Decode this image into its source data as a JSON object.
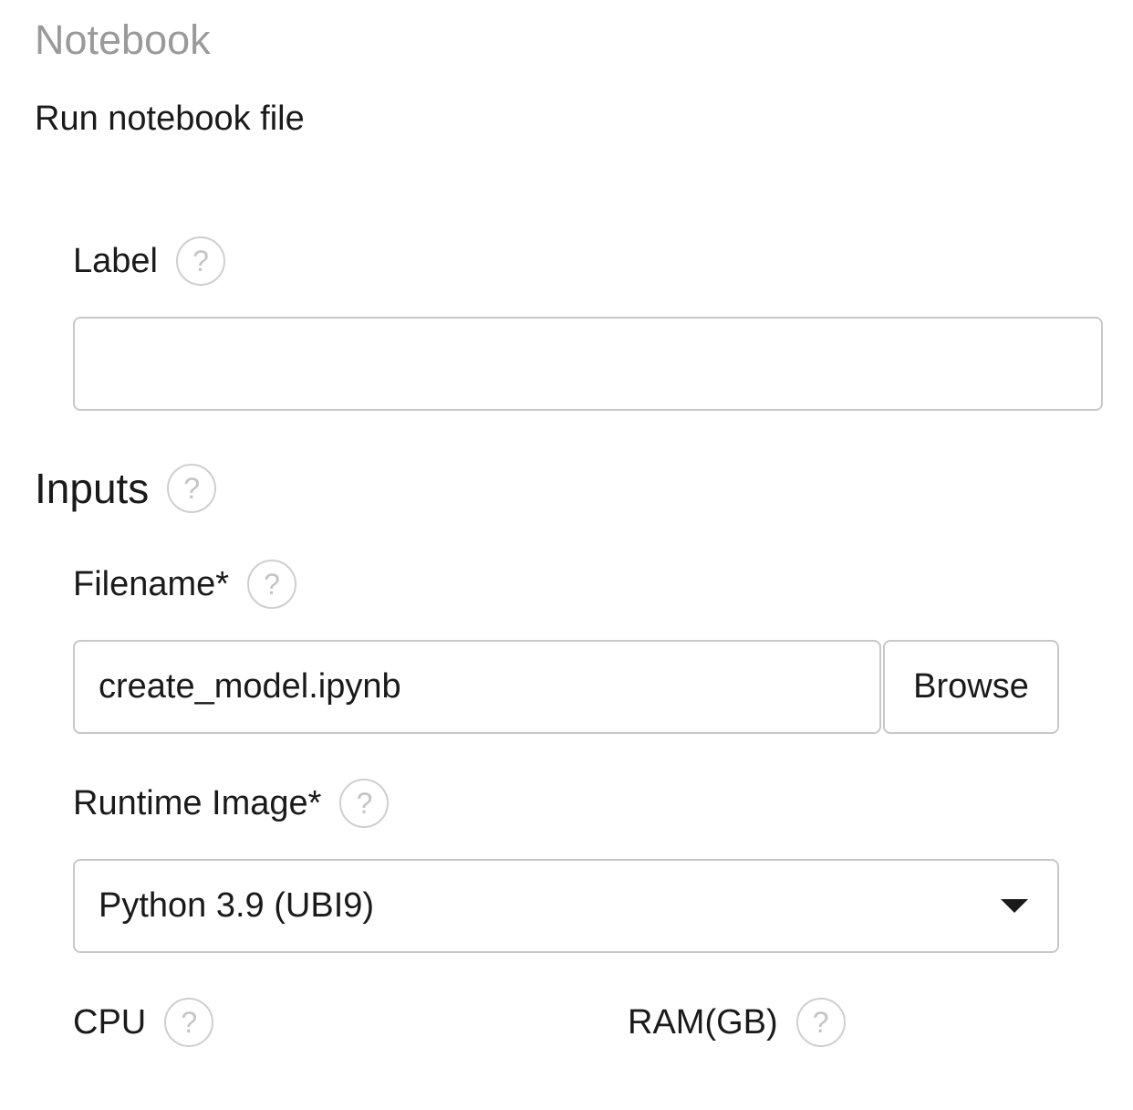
{
  "header": {
    "node_type": "Notebook",
    "description": "Run notebook file"
  },
  "label_field": {
    "label": "Label",
    "value": ""
  },
  "inputs_section": {
    "title": "Inputs"
  },
  "filename_field": {
    "label": "Filename*",
    "value": "create_model.ipynb",
    "browse_label": "Browse"
  },
  "runtime_image_field": {
    "label": "Runtime Image*",
    "selected": "Python 3.9 (UBI9)"
  },
  "cpu_field": {
    "label": "CPU"
  },
  "ram_field": {
    "label": "RAM(GB)"
  },
  "help_icon_glyph": "?"
}
